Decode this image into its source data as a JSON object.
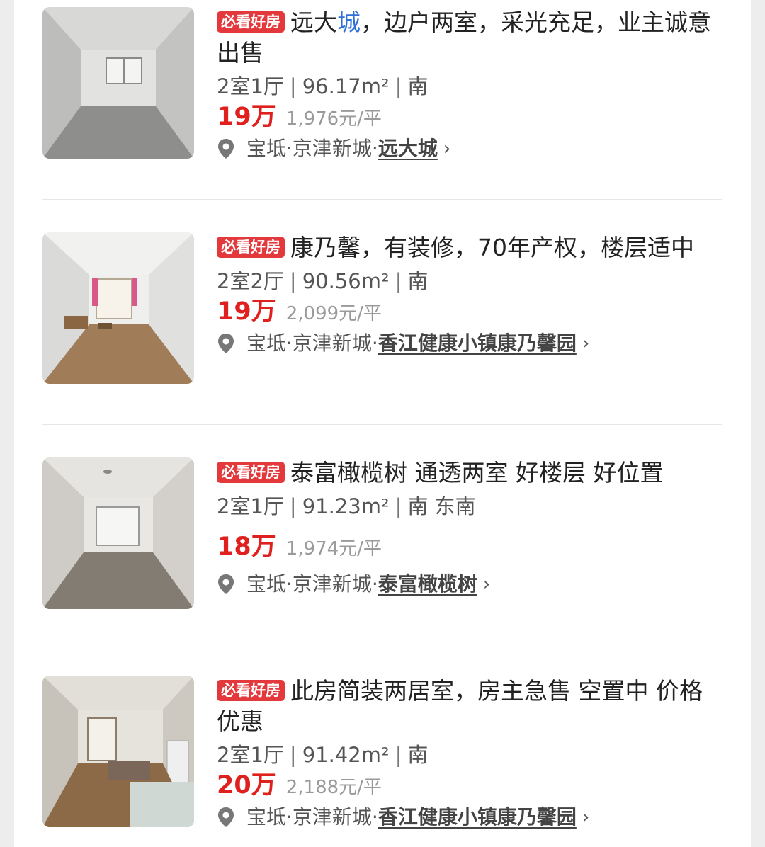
{
  "listings": [
    {
      "badge": "必看好房",
      "title_pre": "远大",
      "title_hl": "城",
      "title_post": "，边户两室，采光充足，业主诚意出售",
      "rooms": "2室1厅",
      "area": "96.17m²",
      "orientation": "南",
      "price": "19万",
      "unit_price": "1,976元/平",
      "district": "宝坻·京津新城·",
      "community": "远大城",
      "chevron": "›"
    },
    {
      "badge": "必看好房",
      "title_pre": "康乃馨，有装修，70年产权，楼层适中",
      "title_hl": "",
      "title_post": "",
      "rooms": "2室2厅",
      "area": "90.56m²",
      "orientation": "南",
      "price": "19万",
      "unit_price": "2,099元/平",
      "district": "宝坻·京津新城·",
      "community": "香江健康小镇康乃馨园",
      "chevron": "›"
    },
    {
      "badge": "必看好房",
      "title_pre": "泰富橄榄树 通透两室 好楼层 好位置",
      "title_hl": "",
      "title_post": "",
      "rooms": "2室1厅",
      "area": "91.23m²",
      "orientation": "南 东南",
      "price": "18万",
      "unit_price": "1,974元/平",
      "district": "宝坻·京津新城·",
      "community": "泰富橄榄树",
      "chevron": "›"
    },
    {
      "badge": "必看好房",
      "title_pre": "此房简装两居室，房主急售 空置中 价格优惠",
      "title_hl": "",
      "title_post": "",
      "rooms": "2室1厅",
      "area": "91.42m²",
      "orientation": "南",
      "price": "20万",
      "unit_price": "2,188元/平",
      "district": "宝坻·京津新城·",
      "community": "香江健康小镇康乃馨园",
      "chevron": "›"
    }
  ],
  "colors": {
    "badge": "#e4393c",
    "price": "#e0201e",
    "highlight": "#2f6fd8",
    "page_bg": "#ededed"
  },
  "icons": [
    "location-pin-icon",
    "chevron-right-icon"
  ]
}
